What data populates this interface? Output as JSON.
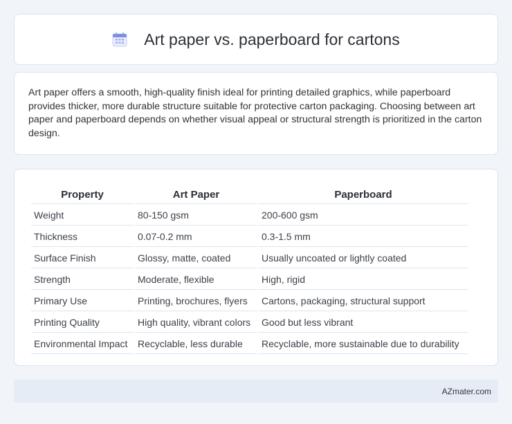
{
  "header": {
    "title": "Art paper vs. paperboard for cartons",
    "icon": "calendar-icon"
  },
  "summary": {
    "text": "Art paper offers a smooth, high-quality finish ideal for printing detailed graphics, while paperboard provides thicker, more durable structure suitable for protective carton packaging. Choosing between art paper and paperboard depends on whether visual appeal or structural strength is prioritized in the carton design."
  },
  "table": {
    "headers": [
      "Property",
      "Art Paper",
      "Paperboard"
    ],
    "rows": [
      [
        "Weight",
        "80-150 gsm",
        "200-600 gsm"
      ],
      [
        "Thickness",
        "0.07-0.2 mm",
        "0.3-1.5 mm"
      ],
      [
        "Surface Finish",
        "Glossy, matte, coated",
        "Usually uncoated or lightly coated"
      ],
      [
        "Strength",
        "Moderate, flexible",
        "High, rigid"
      ],
      [
        "Primary Use",
        "Printing, brochures, flyers",
        "Cartons, packaging, structural support"
      ],
      [
        "Printing Quality",
        "High quality, vibrant colors",
        "Good but less vibrant"
      ],
      [
        "Environmental Impact",
        "Recyclable, less durable",
        "Recyclable, more sustainable due to durability"
      ]
    ]
  },
  "footer": {
    "text": "AZmater.com"
  },
  "colors": {
    "background": "#f1f4f9",
    "card": "#ffffff",
    "footer": "#e6ecf6",
    "icon_accent": "#6b7fd6"
  }
}
